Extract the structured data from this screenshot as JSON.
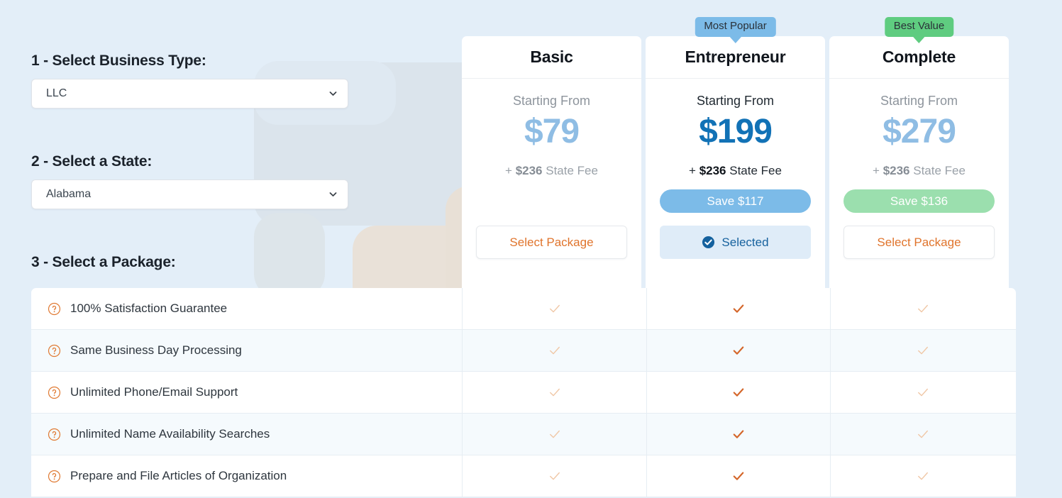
{
  "theme": {
    "page_bg": "#e3eef8",
    "accent_orange": "#e0742c",
    "accent_blue": "#1272b6",
    "badge_blue": "#7cbbe8",
    "badge_green": "#5fcc80",
    "save_green": "#9bdfae",
    "muted_blue": "#8fbde4"
  },
  "configurator": {
    "step1": {
      "label": "1 - Select Business Type:",
      "value": "LLC",
      "icon": "chevron-down-icon"
    },
    "step2": {
      "label": "2 - Select a State:",
      "value": "Alabama",
      "icon": "chevron-down-icon"
    },
    "step3": {
      "label": "3 - Select a Package:"
    }
  },
  "plans": [
    {
      "id": "basic",
      "title": "Basic",
      "badge": null,
      "starting_from": "Starting From",
      "price": "$79",
      "state_fee_prefix": "+",
      "state_fee_amount": "$236",
      "state_fee_suffix": "State Fee",
      "save_label": null,
      "cta_label": "Select Package",
      "selected": false
    },
    {
      "id": "entrepreneur",
      "title": "Entrepreneur",
      "badge": "Most Popular",
      "starting_from": "Starting From",
      "price": "$199",
      "state_fee_prefix": "+",
      "state_fee_amount": "$236",
      "state_fee_suffix": "State Fee",
      "save_label": "Save $117",
      "cta_label": "Selected",
      "cta_icon": "check-circle-icon",
      "selected": true
    },
    {
      "id": "complete",
      "title": "Complete",
      "badge": "Best Value",
      "starting_from": "Starting From",
      "price": "$279",
      "state_fee_prefix": "+",
      "state_fee_amount": "$236",
      "state_fee_suffix": "State Fee",
      "save_label": "Save $136",
      "cta_label": "Select Package",
      "selected": false
    }
  ],
  "features": [
    {
      "name": "100% Satisfaction Guarantee",
      "icon": "help-circle-icon",
      "basic": true,
      "entrepreneur": true,
      "complete": true
    },
    {
      "name": "Same Business Day Processing",
      "icon": "help-circle-icon",
      "basic": true,
      "entrepreneur": true,
      "complete": true
    },
    {
      "name": "Unlimited Phone/Email Support",
      "icon": "help-circle-icon",
      "basic": true,
      "entrepreneur": true,
      "complete": true
    },
    {
      "name": "Unlimited Name Availability Searches",
      "icon": "help-circle-icon",
      "basic": true,
      "entrepreneur": true,
      "complete": true
    },
    {
      "name": "Prepare and File Articles of Organization",
      "icon": "help-circle-icon",
      "basic": true,
      "entrepreneur": true,
      "complete": true
    }
  ]
}
